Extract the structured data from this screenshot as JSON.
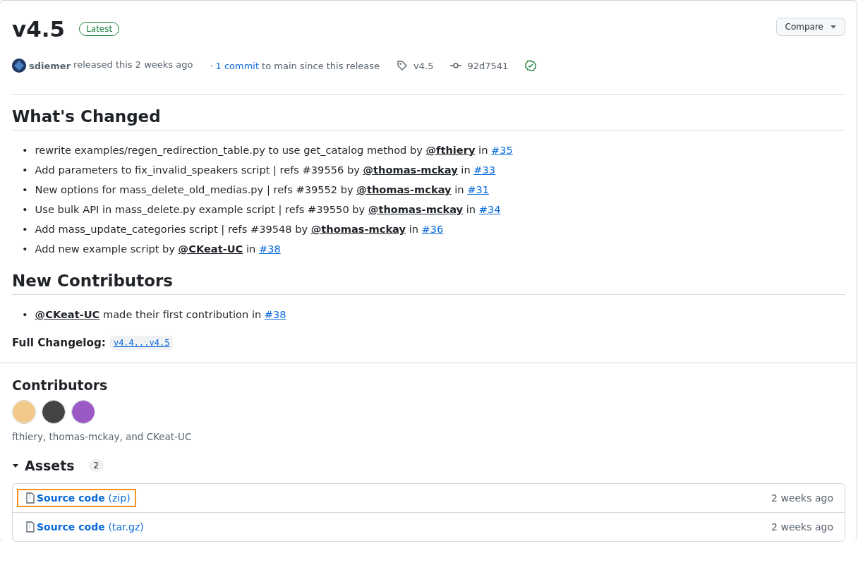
{
  "release": {
    "title": "v4.5",
    "badge": "Latest",
    "compare_button": "Compare",
    "author": "sdiemer",
    "released": "released this 2 weeks ago",
    "commits_link": "1 commit",
    "commits_text": "to main since this release",
    "separator": "·",
    "tag": "v4.5",
    "commit": "92d7541",
    "verified": true
  },
  "whats_changed": {
    "heading": "What's Changed",
    "items": [
      {
        "text": "rewrite examples/regen_redirection_table.py to use get_catalog method by",
        "user": "@fthiery",
        "connector": "in",
        "pr": "#35"
      },
      {
        "text": "Add parameters to fix_invalid_speakers script | refs #39556 by",
        "user": "@thomas-mckay",
        "connector": "in",
        "pr": "#33"
      },
      {
        "text": "New options for mass_delete_old_medias.py | refs #39552 by",
        "user": "@thomas-mckay",
        "connector": "in",
        "pr": "#31"
      },
      {
        "text": "Use bulk API in mass_delete.py example script | refs #39550 by",
        "user": "@thomas-mckay",
        "connector": "in",
        "pr": "#34"
      },
      {
        "text": "Add mass_update_categories script | refs #39548 by",
        "user": "@thomas-mckay",
        "connector": "in",
        "pr": "#36"
      },
      {
        "text": "Add new example script by",
        "user": "@CKeat-UC",
        "connector": "in",
        "pr": "#38"
      }
    ]
  },
  "new_contributors": {
    "heading": "New Contributors",
    "items": [
      {
        "user": "@CKeat-UC",
        "text": "made their first contribution in",
        "pr": "#38"
      }
    ]
  },
  "list_marker": "•",
  "full_changelog": {
    "label": "Full Changelog:",
    "link": "v4.4...v4.5"
  },
  "contributors": {
    "heading": "Contributors",
    "avatars": [
      {
        "color": "#f3c98b"
      },
      {
        "color": "#444444"
      },
      {
        "color": "#9b59c6"
      }
    ],
    "names": "fthiery, thomas-mckay, and CKeat-UC"
  },
  "assets": {
    "heading": "Assets",
    "count": "2",
    "expanded": true,
    "items": [
      {
        "name": "Source code",
        "ext": "(zip)",
        "time": "2 weeks ago",
        "highlighted": true
      },
      {
        "name": "Source code",
        "ext": "(tar.gz)",
        "time": "2 weeks ago",
        "highlighted": false
      }
    ]
  }
}
